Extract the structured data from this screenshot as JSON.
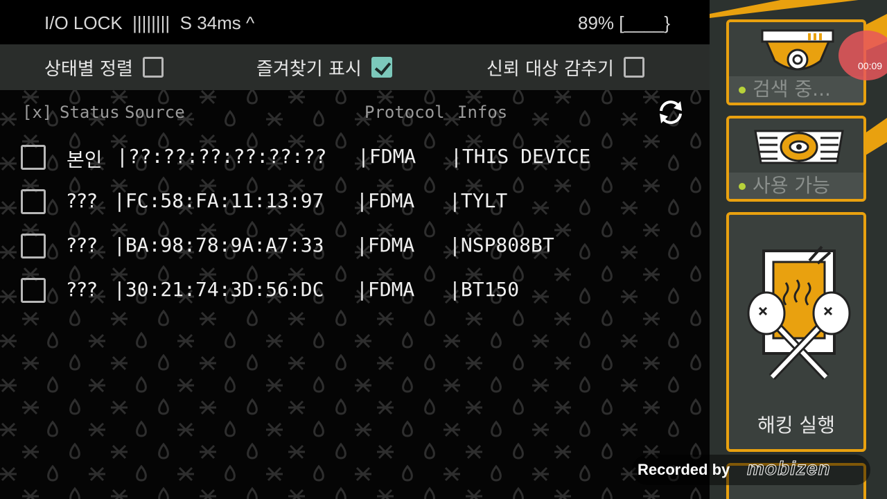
{
  "status_bar": {
    "left_text": "I/O LOCK  ||||||||  S 34ms ^",
    "right_text": "89% [____}"
  },
  "filters": [
    {
      "label": "상태별 정렬",
      "checked": false
    },
    {
      "label": "즐겨찾기 표시",
      "checked": true
    },
    {
      "label": "신뢰 대상 감추기",
      "checked": false
    }
  ],
  "columns": {
    "mark": "[x]",
    "status": "Status",
    "source": "Source",
    "protocol": "Protocol",
    "infos": "Infos"
  },
  "rows": [
    {
      "status": "본인",
      "source": "|??:??:??:??:??:??",
      "protocol": "|FDMA",
      "info": "|THIS DEVICE"
    },
    {
      "status": "???",
      "source": "|FC:58:FA:11:13:97",
      "protocol": "|FDMA",
      "info": "|TYLT"
    },
    {
      "status": "???",
      "source": "|BA:98:78:9A:A7:33",
      "protocol": "|FDMA",
      "info": "|NSP808BT"
    },
    {
      "status": "???",
      "source": "|30:21:74:3D:56:DC",
      "protocol": "|FDMA",
      "info": "|BT150"
    }
  ],
  "side_panel": {
    "scan_label": "검색 중...",
    "available_label": "사용 가능",
    "hack_label": "해킹 실행"
  },
  "recording": {
    "timer": "00:09",
    "recorded_by": "Recorded by",
    "brand": "mobizen"
  },
  "colors": {
    "accent_orange": "#e9a10f",
    "check_teal": "#7cc8bb",
    "status_dot": "#b7d23a",
    "panel_bg": "#2c322f"
  },
  "icons": {
    "refresh": "refresh-icon",
    "scan": "camera-scan-icon",
    "available": "eye-scanner-icon",
    "hack": "hack-clubs-icon"
  }
}
